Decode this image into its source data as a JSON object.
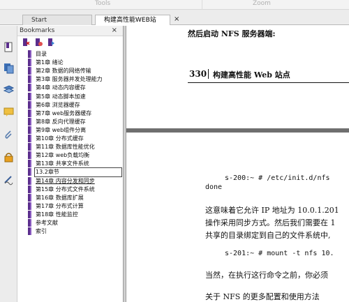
{
  "toolbar": {
    "tools_label": "Tools",
    "zoom_label": "Zoom"
  },
  "tabs": [
    {
      "label": "Start"
    },
    {
      "label": "构建高性能WEB站点.p...",
      "close": "×"
    }
  ],
  "bookmarks_panel": {
    "title": "Bookmarks",
    "close": "×",
    "items": [
      {
        "label": "目录"
      },
      {
        "label": "第1章 绪论"
      },
      {
        "label": "第2章 数据的网络传输"
      },
      {
        "label": "第3章 服务器并发处理能力"
      },
      {
        "label": "第4章 动态内容缓存"
      },
      {
        "label": "第5章 动态脚本加速"
      },
      {
        "label": "第6章 浏览器缓存"
      },
      {
        "label": "第7章 web服务器缓存"
      },
      {
        "label": "第8章 反向代理缓存"
      },
      {
        "label": "第9章 web组件分离"
      },
      {
        "label": "第10章 分布式缓存"
      },
      {
        "label": "第11章 数据库性能优化"
      },
      {
        "label": "第12章 web负载均衡"
      },
      {
        "label": "第13章 共享文件系统"
      },
      {
        "label": "13.2章节"
      },
      {
        "label": "第14章 内容分发和同步"
      },
      {
        "label": "第15章 分布式文件系统"
      },
      {
        "label": "第16章 数据库扩展"
      },
      {
        "label": "第17章 分布式计算"
      },
      {
        "label": "第18章 性能监控"
      },
      {
        "label": "参考文献"
      },
      {
        "label": "索引"
      }
    ]
  },
  "document": {
    "page1_line": "然后启动 NFS 服务器端:",
    "page_number": "330",
    "running_head": "构建高性能 Web 站点",
    "cmd1_line1": "s-200:~ # /etc/init.d/nfs",
    "cmd1_line2": "done",
    "para1_line1": "这意味着它允许 IP 地址为 10.0.1.201",
    "para1_line2": "操作采用同步方式。然后我们需要在 1",
    "para1_line3": "共享的目录绑定到自己的文件系统中,",
    "cmd2": "s-201:~ # mount -t nfs 10.",
    "para2": "当然，在执行这行命令之前，你必须",
    "para3": "关于 NFS 的更多配置和使用方法"
  },
  "colors": {
    "bookmark_flag": "#5a2d8c",
    "doc_background": "#6f6f6f"
  }
}
